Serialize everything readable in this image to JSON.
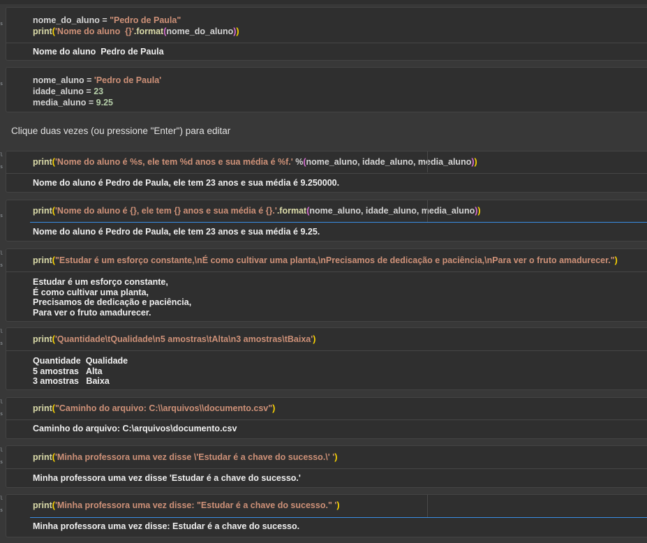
{
  "markdown": {
    "placeholder": "Clique duas vezes (ou pressione \"Enter\") para editar"
  },
  "cells": [
    {
      "code": [
        [
          [
            "nome_do_aluno",
            "txt"
          ],
          [
            " = ",
            "txt"
          ],
          [
            "\"Pedro de Paula\"",
            "str"
          ]
        ],
        [
          [
            "print",
            "fn"
          ],
          [
            "(",
            "p1"
          ],
          [
            "'Nome do aluno  {}'",
            "str"
          ],
          [
            ".format",
            "fn"
          ],
          [
            "(",
            "p2"
          ],
          [
            "nome_do_aluno",
            "txt"
          ],
          [
            ")",
            "p2"
          ],
          [
            ")",
            "p1"
          ]
        ]
      ],
      "output": "Nome do aluno  Pedro de Paula"
    },
    {
      "code": [
        [
          [
            "nome_aluno",
            "txt"
          ],
          [
            " = ",
            "txt"
          ],
          [
            "'Pedro de Paula'",
            "str"
          ]
        ],
        [
          [
            "idade_aluno",
            "txt"
          ],
          [
            " = ",
            "txt"
          ],
          [
            "23",
            "num"
          ]
        ],
        [
          [
            "media_aluno",
            "txt"
          ],
          [
            " = ",
            "txt"
          ],
          [
            "9.25",
            "num"
          ]
        ]
      ],
      "output": ""
    },
    {
      "code": [
        [
          [
            "print",
            "fn"
          ],
          [
            "(",
            "p1"
          ],
          [
            "'Nome do aluno é %s, ele tem %d anos e sua média é %f.'",
            "str"
          ],
          [
            " %",
            "txt"
          ],
          [
            "(",
            "p2"
          ],
          [
            "nome_aluno, idade_aluno, media_aluno",
            "txt"
          ],
          [
            ")",
            "p2"
          ],
          [
            ")",
            "p1"
          ]
        ]
      ],
      "output": "Nome do aluno é Pedro de Paula, ele tem 23 anos e sua média é 9.250000."
    },
    {
      "code": [
        [
          [
            "print",
            "fn"
          ],
          [
            "(",
            "p1"
          ],
          [
            "'Nome do aluno é {}, ele tem {} anos e sua média é {}.'",
            "str"
          ],
          [
            ".format",
            "fn"
          ],
          [
            "(",
            "p2"
          ],
          [
            "nome_aluno, idade_aluno, media_aluno",
            "txt"
          ],
          [
            ")",
            "p2"
          ],
          [
            ")",
            "p1"
          ]
        ]
      ],
      "output": "Nome do aluno é Pedro de Paula, ele tem 23 anos e sua média é 9.25."
    },
    {
      "code": [
        [
          [
            "print",
            "fn"
          ],
          [
            "(",
            "p1"
          ],
          [
            "\"Estudar é um esforço constante,\\nÉ como cultivar uma planta,\\nPrecisamos de dedicação e paciência,\\nPara ver o fruto amadurecer.\"",
            "str"
          ],
          [
            ")",
            "p1"
          ]
        ]
      ],
      "output": "Estudar é um esforço constante,\nÉ como cultivar uma planta,\nPrecisamos de dedicação e paciência,\nPara ver o fruto amadurecer."
    },
    {
      "code": [
        [
          [
            "print",
            "fn"
          ],
          [
            "(",
            "p1"
          ],
          [
            "'Quantidade\\tQualidade\\n5 amostras\\tAlta\\n3 amostras\\tBaixa'",
            "str"
          ],
          [
            ")",
            "p1"
          ]
        ]
      ],
      "output": "Quantidade  Qualidade\n5 amostras   Alta\n3 amostras   Baixa"
    },
    {
      "code": [
        [
          [
            "print",
            "fn"
          ],
          [
            "(",
            "p1"
          ],
          [
            "\"Caminho do arquivo: C:\\\\arquivos\\\\documento.csv\"",
            "str"
          ],
          [
            ")",
            "p1"
          ]
        ]
      ],
      "output": "Caminho do arquivo: C:\\arquivos\\documento.csv"
    },
    {
      "code": [
        [
          [
            "print",
            "fn"
          ],
          [
            "(",
            "p1"
          ],
          [
            "'Minha professora uma vez disse \\'Estudar é a chave do sucesso.\\' '",
            "str"
          ],
          [
            ")",
            "p1"
          ]
        ]
      ],
      "output": "Minha professora uma vez disse 'Estudar é a chave do sucesso.'"
    },
    {
      "code": [
        [
          [
            "print",
            "fn"
          ],
          [
            "(",
            "p1"
          ],
          [
            "'Minha professora uma vez disse: \"Estudar é a chave do sucesso.\" '",
            "str"
          ],
          [
            ")",
            "p1"
          ]
        ]
      ],
      "output": "Minha professora uma vez disse: Estudar é a chave do sucesso."
    }
  ],
  "colors": {
    "background": "#383838",
    "cell": "#2f2f2f",
    "function": "#dcdcaa",
    "string": "#ce9178",
    "number": "#b5cea8",
    "bracket_outer": "#ffd700",
    "bracket_inner": "#da70d6",
    "active_border": "#3a8ee6"
  },
  "icons": [
    "run-status-icon"
  ]
}
